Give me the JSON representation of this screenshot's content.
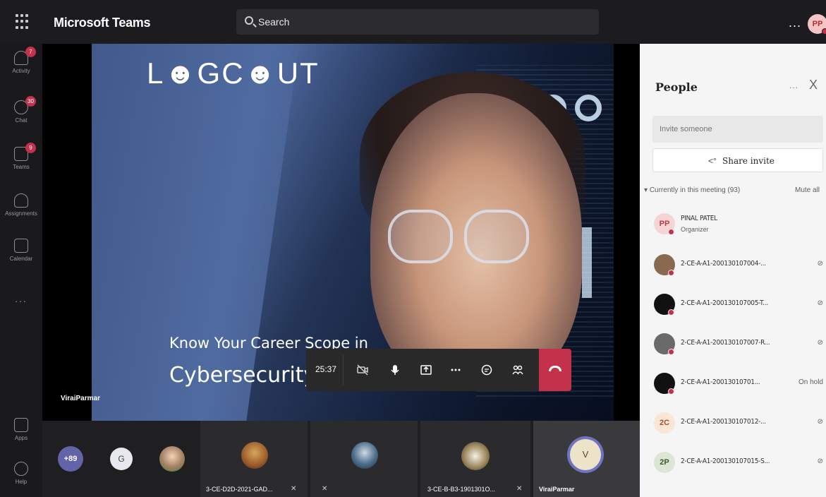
{
  "topbar": {
    "app_title": "Microsoft Teams",
    "search_placeholder": "Search",
    "more_label": "...",
    "avatar_initials": "PP"
  },
  "rail": {
    "items": [
      {
        "label": "Activity",
        "icon": "bell-icon",
        "badge": "7"
      },
      {
        "label": "Chat",
        "icon": "chat-icon",
        "badge": "30"
      },
      {
        "label": "Teams",
        "icon": "teams-icon",
        "badge": "9"
      },
      {
        "label": "Assignments",
        "icon": "assignments-icon",
        "badge": ""
      },
      {
        "label": "Calendar",
        "icon": "calendar-icon",
        "badge": ""
      },
      {
        "label": "Apps",
        "icon": "apps-icon",
        "badge": ""
      },
      {
        "label": "Help",
        "icon": "help-icon",
        "badge": ""
      }
    ],
    "more_label": "..."
  },
  "stage": {
    "logo": "L☻GC☻UT",
    "slide_subtitle": "Know Your Career Scope in",
    "slide_title": "Cybersecurity",
    "speaker_name": "ViraiParmar"
  },
  "controls": {
    "timer": "25:37",
    "buttons": [
      "camera-off-icon",
      "microphone-icon",
      "share-screen-icon",
      "more-icon",
      "chat-icon",
      "participants-icon",
      "hang-up-icon"
    ]
  },
  "strip": {
    "overflow_count": "+89",
    "g_initial": "G",
    "tiles": [
      {
        "name": "3-CE-D2D-2021-GAD...",
        "muted": true
      },
      {
        "name": "",
        "muted": true
      },
      {
        "name": "3-CE-B-B3-1901301O...",
        "muted": true
      },
      {
        "name": "ViraiParmar",
        "initial": "V"
      }
    ]
  },
  "panel": {
    "title": "People",
    "more_label": "...",
    "close_label": "X",
    "invite_placeholder": "Invite someone",
    "share_invite": "Share invite",
    "section_label": "Currently in this meeting (93)",
    "mute_all": "Mute all",
    "people": [
      {
        "initials": "PP",
        "name": "PINAL PATEL",
        "role": "Organizer",
        "status": "",
        "avatar_color": "#f6d4d4",
        "text_color": "#b43c4c"
      },
      {
        "initials": "",
        "name": "2-CE-A-A1-200130107004-...",
        "role": "",
        "status": "muted",
        "avatar_color": "#8a6a4f",
        "text_color": "#ffffff"
      },
      {
        "initials": "",
        "name": "2-CE-A-A1-200130107005-T...",
        "role": "",
        "status": "muted",
        "avatar_color": "#111111",
        "text_color": "#ffffff"
      },
      {
        "initials": "",
        "name": "2-CE-A-A1-200130107007-R...",
        "role": "",
        "status": "muted",
        "avatar_color": "#6a6a6a",
        "text_color": "#ffffff"
      },
      {
        "initials": "",
        "name": "2-CE-A-A1-20013010701...",
        "role": "",
        "status": "On hold",
        "avatar_color": "#111111",
        "text_color": "#ffffff"
      },
      {
        "initials": "2C",
        "name": "2-CE-A-A1-200130107012-...",
        "role": "",
        "status": "muted",
        "avatar_color": "#fbe5d4",
        "text_color": "#a0522d"
      },
      {
        "initials": "2P",
        "name": "2-CE-A-A1-200130107015-S...",
        "role": "",
        "status": "muted",
        "avatar_color": "#dde6d5",
        "text_color": "#3a5a30"
      }
    ]
  },
  "colors": {
    "accent": "#6264a7",
    "hangup": "#c4314b",
    "presence_busy": "#c4314b"
  }
}
